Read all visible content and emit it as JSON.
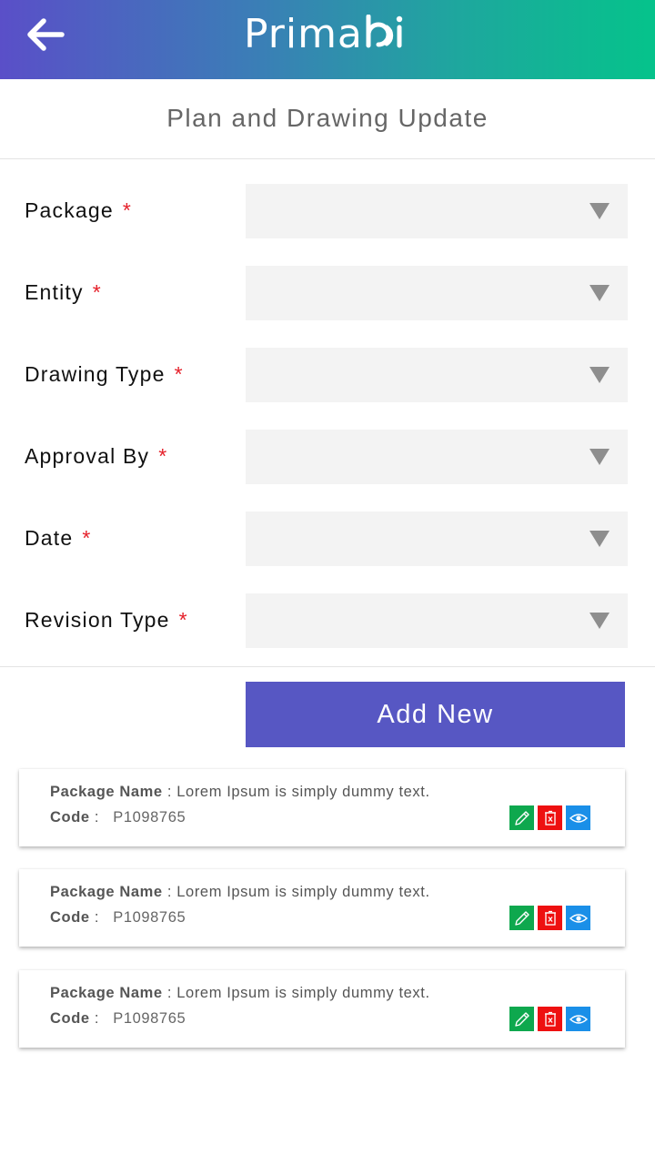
{
  "header": {
    "app_name": "Primabi",
    "logo_text": "Prima",
    "logo_mark": "bi",
    "back_icon": "arrow-left-icon",
    "colors": {
      "gradient_start": "#5a4fc8",
      "gradient_end": "#05c38b"
    }
  },
  "page": {
    "title": "Plan and Drawing Update"
  },
  "form": {
    "required_marker": "*",
    "fields": [
      {
        "label": "Package",
        "value": ""
      },
      {
        "label": "Entity",
        "value": ""
      },
      {
        "label": "Drawing Type",
        "value": ""
      },
      {
        "label": "Approval By",
        "value": ""
      },
      {
        "label": "Date",
        "value": ""
      },
      {
        "label": "Revision Type",
        "value": ""
      }
    ],
    "dropdown_icon": "caret-down-icon"
  },
  "add_button": {
    "label": "Add New",
    "color": "#5757c3"
  },
  "items": [
    {
      "name_label": "Package Name",
      "separator": ":",
      "name_value": "Lorem Ipsum is simply dummy text.",
      "code_label": "Code",
      "code_separator": ":",
      "code_value": "P1098765"
    },
    {
      "name_label": "Package Name",
      "separator": ":",
      "name_value": "Lorem Ipsum is simply dummy text.",
      "code_label": "Code",
      "code_separator": ":",
      "code_value": "P1098765"
    },
    {
      "name_label": "Package Name",
      "separator": ":",
      "name_value": "Lorem Ipsum is simply dummy text.",
      "code_label": "Code",
      "code_separator": ":",
      "code_value": "P1098765"
    }
  ],
  "item_actions": {
    "edit": {
      "icon": "pencil-icon",
      "color": "#0ea84e"
    },
    "delete": {
      "icon": "trash-icon",
      "color": "#ee1010"
    },
    "view": {
      "icon": "eye-icon",
      "color": "#1a8fe8"
    }
  }
}
